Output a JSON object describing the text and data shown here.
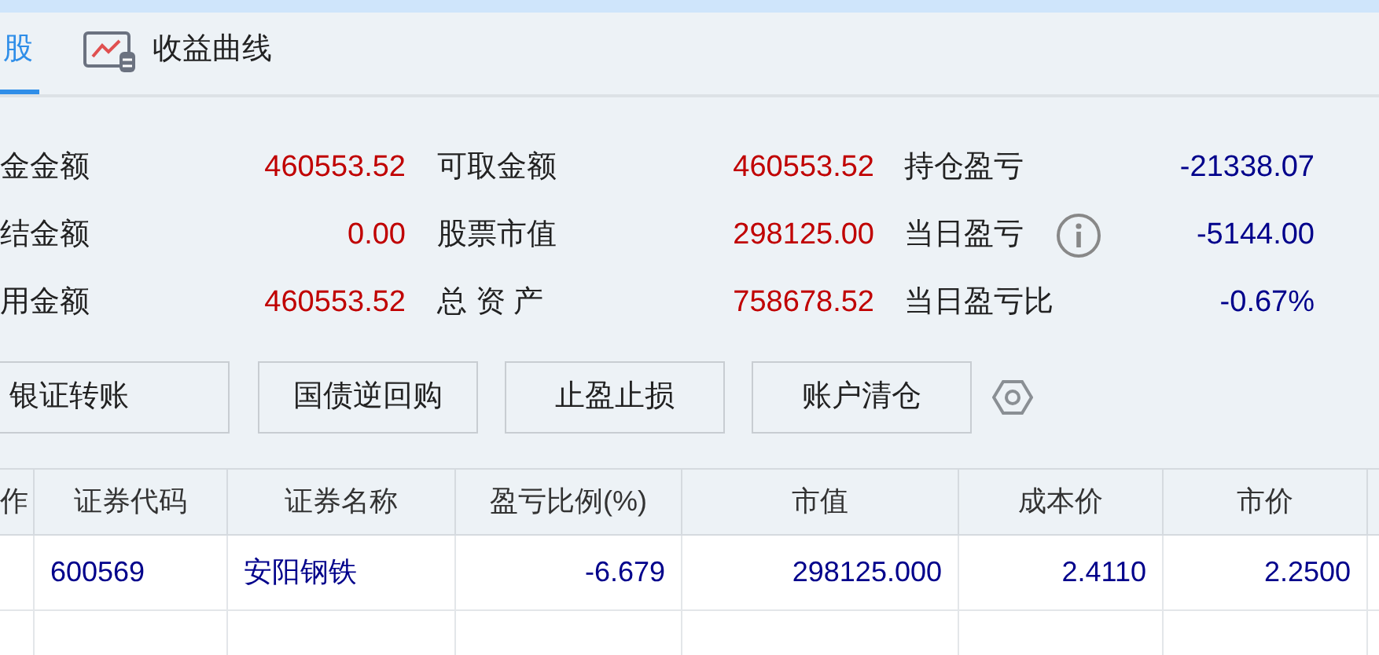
{
  "tabs": [
    {
      "label": "股",
      "selected": true,
      "kind": "text"
    },
    {
      "label": "收益曲线",
      "selected": false,
      "kind": "icon"
    }
  ],
  "summary": [
    [
      {
        "label": "金金额",
        "value": "460553.52",
        "color": "#c00000"
      },
      {
        "label": "可取金额",
        "value": "460553.52",
        "color": "#c00000"
      },
      {
        "label": "持仓盈亏",
        "value": "-21338.07",
        "color": "#00008b"
      }
    ],
    [
      {
        "label": "结金额",
        "value": "0.00",
        "color": "#c00000"
      },
      {
        "label": "股票市值",
        "value": "298125.00",
        "color": "#c00000"
      },
      {
        "label": "当日盈亏",
        "value": "-5144.00",
        "color": "#00008b",
        "info": true
      }
    ],
    [
      {
        "label": "用金额",
        "value": "460553.52",
        "color": "#c00000"
      },
      {
        "label": "总 资 产",
        "value": "758678.52",
        "color": "#c00000"
      },
      {
        "label": "当日盈亏比",
        "value": "-0.67%",
        "color": "#00008b"
      }
    ]
  ],
  "buttons": [
    "银证转账",
    "国债逆回购",
    "止盈止损",
    "账户清仓"
  ],
  "table": {
    "columns": [
      "作",
      "证券代码",
      "证券名称",
      "盈亏比例(%)",
      "市值",
      "成本价",
      "市价"
    ],
    "rows": [
      [
        "",
        "600569",
        "安阳钢铁",
        "-6.679",
        "298125.000",
        "2.4110",
        "2.2500"
      ]
    ]
  }
}
